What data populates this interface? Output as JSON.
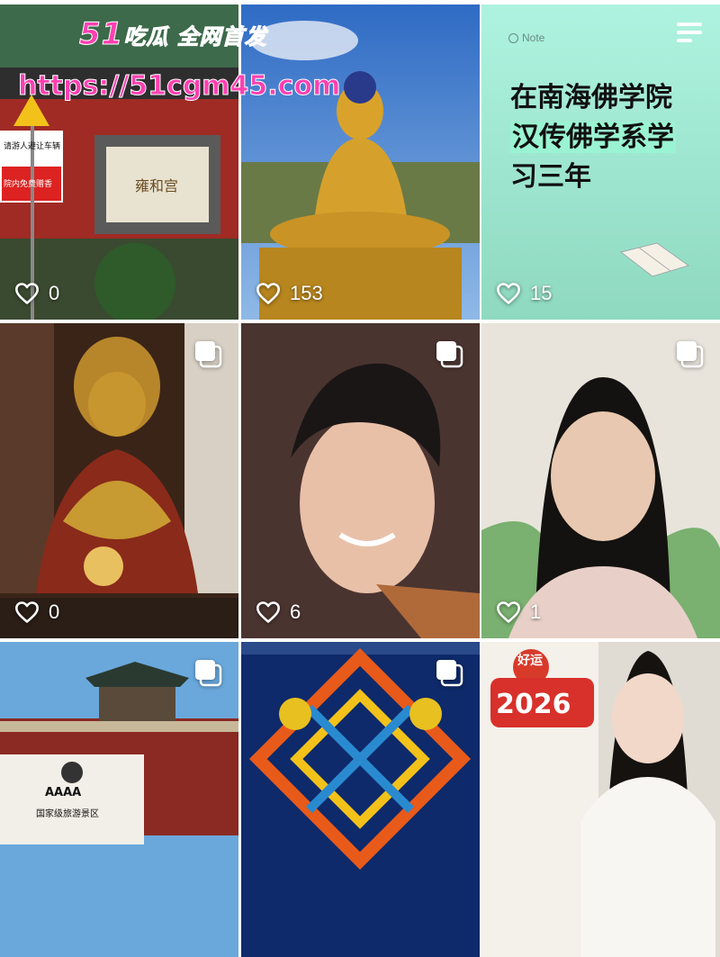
{
  "watermark": {
    "site_name_prefix": "51",
    "site_name_rest": "吃瓜 全网首发",
    "url": "https://51cgm45.com"
  },
  "tiles": [
    {
      "likes": "0",
      "sign_text": "请游人避让车辆",
      "sign_text2": "院内免费赠香",
      "plaque": "雍和宫"
    },
    {
      "likes": "153"
    },
    {
      "likes": "15",
      "note_label": "Note",
      "note_line1": "在南海佛学院",
      "note_line2": "汉传佛学系学",
      "note_line3": "习三年"
    },
    {
      "likes": "0"
    },
    {
      "likes": "6"
    },
    {
      "likes": "1"
    },
    {
      "likes": "",
      "rating": "AAAA",
      "scenic_name": "国家级旅游景区"
    },
    {
      "likes": ""
    },
    {
      "likes": "",
      "badge_text": "好运",
      "year": "2026"
    }
  ],
  "colors": {
    "watermark": "#ff3fb0",
    "note_bg": "#a8f0dc",
    "like_icon": "#ffffff"
  },
  "icons": {
    "like": "heart-outline-icon",
    "multi": "multi-image-icon",
    "menu": "menu-lines-icon"
  }
}
